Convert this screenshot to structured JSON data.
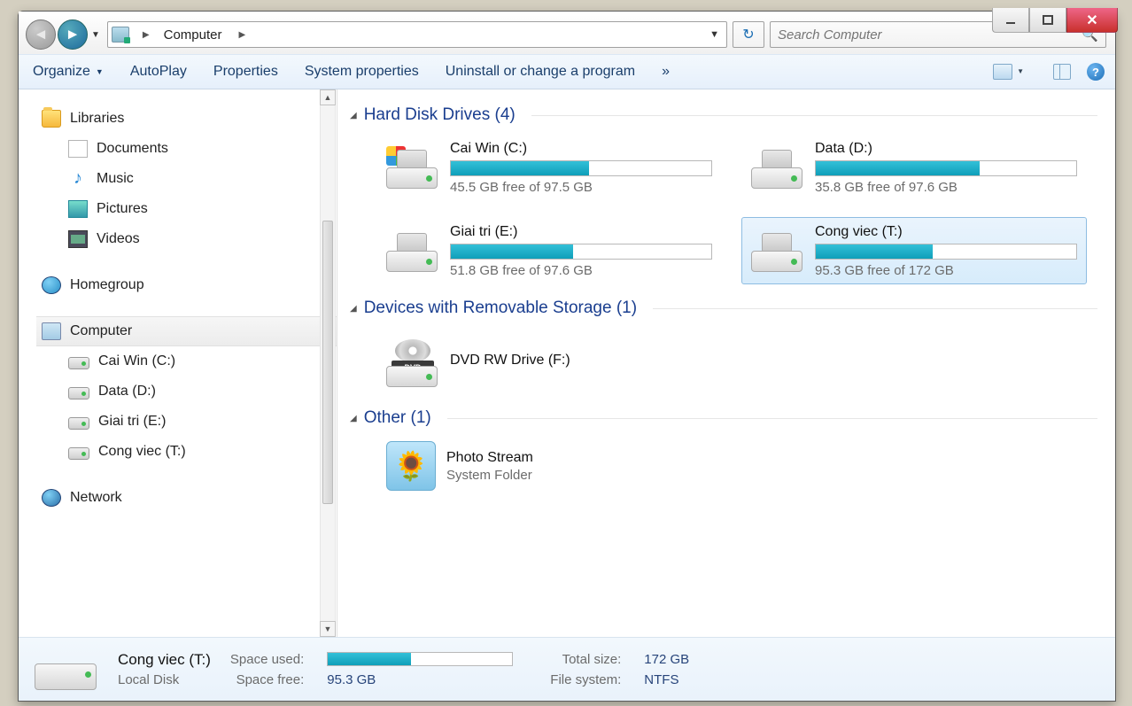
{
  "address": {
    "location": "Computer"
  },
  "search": {
    "placeholder": "Search Computer"
  },
  "toolbar": {
    "organize": "Organize",
    "autoplay": "AutoPlay",
    "properties": "Properties",
    "sysprops": "System properties",
    "uninstall": "Uninstall or change a program",
    "overflow": "»"
  },
  "sidebar": {
    "libraries": "Libraries",
    "documents": "Documents",
    "music": "Music",
    "pictures": "Pictures",
    "videos": "Videos",
    "homegroup": "Homegroup",
    "computer": "Computer",
    "drives": [
      {
        "label": "Cai Win (C:)"
      },
      {
        "label": "Data (D:)"
      },
      {
        "label": "Giai tri (E:)"
      },
      {
        "label": "Cong viec (T:)"
      }
    ],
    "network": "Network"
  },
  "sections": {
    "hdd": "Hard Disk Drives (4)",
    "removable": "Devices with Removable Storage (1)",
    "other": "Other (1)"
  },
  "drives": [
    {
      "name": "Cai Win (C:)",
      "free": "45.5 GB free of 97.5 GB",
      "fill": 53,
      "os": true
    },
    {
      "name": "Data (D:)",
      "free": "35.8 GB free of 97.6 GB",
      "fill": 63
    },
    {
      "name": "Giai tri (E:)",
      "free": "51.8 GB free of 97.6 GB",
      "fill": 47
    },
    {
      "name": "Cong viec (T:)",
      "free": "95.3 GB free of 172 GB",
      "fill": 45,
      "selected": true
    }
  ],
  "removable": {
    "name": "DVD RW Drive (F:)",
    "badge": "DVD"
  },
  "other": {
    "name": "Photo Stream",
    "type": "System Folder"
  },
  "details": {
    "name": "Cong viec (T:)",
    "type": "Local Disk",
    "labels": {
      "used": "Space used:",
      "free": "Space free:",
      "total": "Total size:",
      "fs": "File system:"
    },
    "used_fill": 45,
    "free": "95.3 GB",
    "total": "172 GB",
    "fs": "NTFS"
  }
}
